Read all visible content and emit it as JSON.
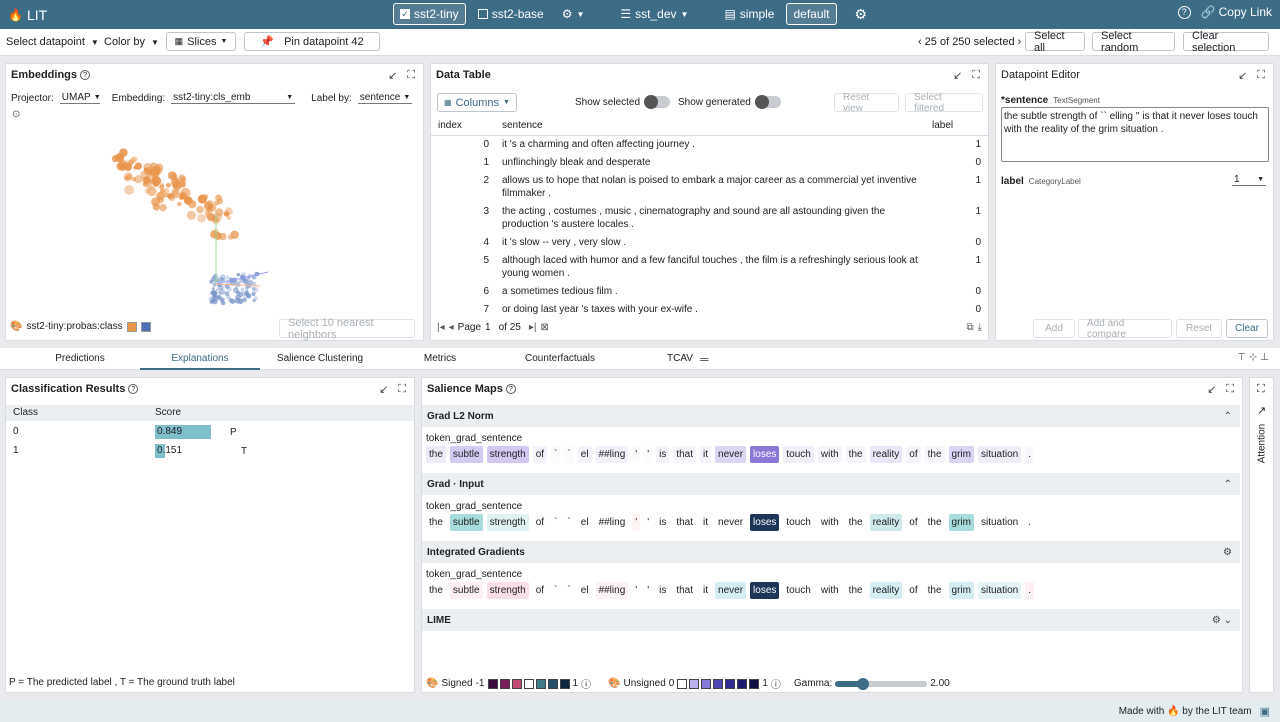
{
  "app": {
    "title": "LIT",
    "logo_icon": "fire-icon"
  },
  "topbar": {
    "models": [
      {
        "label": "sst2-tiny",
        "selected": true
      },
      {
        "label": "sst2-base",
        "selected": false
      }
    ],
    "dataset": "sst_dev",
    "layouts": [
      {
        "label": "simple",
        "selected": false
      },
      {
        "label": "default",
        "selected": true
      }
    ],
    "copy_link": "Copy Link"
  },
  "toolbar": {
    "select_datapoint": "Select datapoint",
    "color_by": "Color by",
    "slices": "Slices",
    "pin": "Pin datapoint 42",
    "selection_count": "25 of 250 selected",
    "select_all": "Select all",
    "select_random": "Select random",
    "clear_selection": "Clear selection"
  },
  "embeddings": {
    "title": "Embeddings",
    "projector_label": "Projector:",
    "projector_value": "UMAP",
    "embedding_label": "Embedding:",
    "embedding_value": "sst2-tiny:cls_emb",
    "label_by_label": "Label by:",
    "label_by_value": "sentence",
    "color_legend": "sst2-tiny:probas:class",
    "legend_colors": [
      "#e8944a",
      "#4a72b4"
    ],
    "nearest_button": "Select 10 nearest neighbors"
  },
  "data_table": {
    "title": "Data Table",
    "columns_button": "Columns",
    "show_selected": "Show selected",
    "show_generated": "Show generated",
    "reset_view": "Reset view",
    "select_filtered": "Select filtered",
    "headers": [
      "index",
      "sentence",
      "label"
    ],
    "rows": [
      {
        "index": "0",
        "sentence": "it 's a charming and often affecting journey .",
        "label": "1"
      },
      {
        "index": "1",
        "sentence": "unflinchingly bleak and desperate",
        "label": "0"
      },
      {
        "index": "2",
        "sentence": "allows us to hope that nolan is poised to embark a major career as a commercial yet inventive filmmaker .",
        "label": "1"
      },
      {
        "index": "3",
        "sentence": "the acting , costumes , music , cinematography and sound are all astounding given the production 's austere locales .",
        "label": "1"
      },
      {
        "index": "4",
        "sentence": "it 's slow -- very , very slow .",
        "label": "0"
      },
      {
        "index": "5",
        "sentence": "although laced with humor and a few fanciful touches , the film is a refreshingly serious look at young women .",
        "label": "1"
      },
      {
        "index": "6",
        "sentence": "a sometimes tedious film .",
        "label": "0"
      },
      {
        "index": "7",
        "sentence": "or doing last year 's taxes with your ex-wife .",
        "label": "0"
      }
    ],
    "page_label": "Page",
    "page_value": "1",
    "page_of": "of 25"
  },
  "datapoint_editor": {
    "title": "Datapoint Editor",
    "field1_name": "*sentence",
    "field1_type": "TextSegment",
    "field1_value": "the subtle strength of `` elling '' is that it never loses touch with the reality of the grim situation .",
    "field2_name": "label",
    "field2_type": "CategoryLabel",
    "field2_value": "1",
    "add": "Add",
    "add_compare": "Add and compare",
    "reset": "Reset",
    "clear": "Clear"
  },
  "tabs": [
    {
      "label": "Predictions",
      "active": false
    },
    {
      "label": "Explanations",
      "active": true
    },
    {
      "label": "Salience Clustering",
      "active": false
    },
    {
      "label": "Metrics",
      "active": false
    },
    {
      "label": "Counterfactuals",
      "active": false
    },
    {
      "label": "TCAV",
      "active": false
    }
  ],
  "classification": {
    "title": "Classification Results",
    "col_class": "Class",
    "col_score": "Score",
    "rows": [
      {
        "class": "0",
        "score": "0.849",
        "score_fraction": 0.849,
        "marker": "P"
      },
      {
        "class": "1",
        "score": "0.151",
        "score_fraction": 0.151,
        "marker": "T"
      }
    ],
    "footnote": "P = The predicted label , T = The ground truth label",
    "bar_color": "#7fbfcc"
  },
  "salience": {
    "title": "Salience Maps",
    "field": "token_grad_sentence",
    "tokens": [
      "the",
      "subtle",
      "strength",
      "of",
      "`",
      "`",
      "el",
      "##ling",
      "'",
      "'",
      "is",
      "that",
      "it",
      "never",
      "loses",
      "touch",
      "with",
      "the",
      "reality",
      "of",
      "the",
      "grim",
      "situation",
      "."
    ],
    "sections": [
      {
        "name": "Grad L2 Norm",
        "colors": [
          "#eeeaf8",
          "#d4cbf2",
          "#d2c8f1",
          "#f4f2fb",
          "#fbfafd",
          "#fbfafd",
          "#f4f2fb",
          "#f2f0fa",
          "#fbfafd",
          "#fbfafd",
          "#f6f4fb",
          "#f7f5fc",
          "#f6f4fb",
          "#ddd5f4",
          "#8a77d6",
          "#f1eefa",
          "#f6f4fb",
          "#f7f5fc",
          "#ebe7f8",
          "#f7f5fc",
          "#f7f5fc",
          "#dcd4f4",
          "#f0edf9",
          "#f8f7fc"
        ]
      },
      {
        "name": "Grad · Input",
        "colors": [
          "#ffffff",
          "#a8dcdc",
          "#dff1f1",
          "#ffffff",
          "#ffffff",
          "#ffffff",
          "#ffffff",
          "#ffffff",
          "#fff4f4",
          "#ffffff",
          "#ffffff",
          "#ffffff",
          "#ffffff",
          "#ffffff",
          "#1d3557",
          "#ffffff",
          "#ffffff",
          "#ffffff",
          "#cfeaea",
          "#ffffff",
          "#ffffff",
          "#a8dcdc",
          "#ffffff",
          "#ffffff"
        ]
      },
      {
        "name": "Integrated Gradients",
        "colors": [
          "#ffffff",
          "#fdeff2",
          "#fbdfe6",
          "#ffffff",
          "#ffffff",
          "#ffffff",
          "#ffffff",
          "#fdf3f5",
          "#ffffff",
          "#ffffff",
          "#ffffff",
          "#ffffff",
          "#ffffff",
          "#d5eef3",
          "#1d3557",
          "#ffffff",
          "#ffffff",
          "#ffffff",
          "#d5eef3",
          "#ffffff",
          "#ffffff",
          "#d5eef3",
          "#e5f4f7",
          "#fdeff2"
        ]
      },
      {
        "name": "LIME",
        "colors": []
      }
    ],
    "legend_signed": "Signed",
    "legend_signed_min": "-1",
    "legend_signed_max": "1",
    "signed_colors": [
      "#3b0b3f",
      "#7b1f5a",
      "#c24d72",
      "#ffffff",
      "#3f7a8a",
      "#24506a",
      "#0e2740"
    ],
    "legend_unsigned": "Unsigned",
    "legend_unsigned_min": "0",
    "legend_unsigned_max": "1",
    "unsigned_colors": [
      "#ffffff",
      "#b9b0ee",
      "#8478d8",
      "#4b46b4",
      "#2f2b92",
      "#1e1b70",
      "#101045"
    ],
    "gamma_label": "Gamma:",
    "gamma_value": "2.00",
    "gamma_fraction": 0.3
  },
  "attention_tab": "Attention",
  "footer": {
    "text": "Made with 🔥 by the LIT team"
  }
}
